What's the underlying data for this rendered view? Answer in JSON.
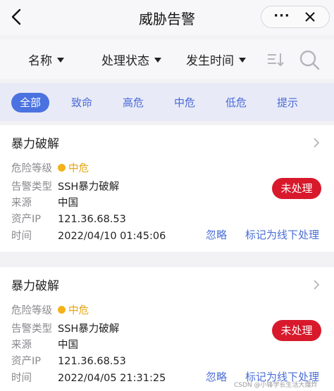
{
  "header": {
    "title": "威胁告警",
    "more_label": "···"
  },
  "filters": [
    {
      "label": "名称"
    },
    {
      "label": "处理状态"
    },
    {
      "label": "发生时间"
    }
  ],
  "tabs": [
    "全部",
    "致命",
    "高危",
    "中危",
    "低危",
    "提示"
  ],
  "active_tab": "全部",
  "fields": {
    "level": "危险等级",
    "type": "告警类型",
    "source": "来源",
    "ip": "资产IP",
    "time": "时间"
  },
  "alerts": [
    {
      "title": "暴力破解",
      "level": "中危",
      "type": "SSH暴力破解",
      "source": "中国",
      "ip": "121.36.68.53",
      "time": "2022/04/10 01:45:06",
      "status": "未处理",
      "ignore": "忽略",
      "mark_offline": "标记为线下处理"
    },
    {
      "title": "暴力破解",
      "level": "中危",
      "type": "SSH暴力破解",
      "source": "中国",
      "ip": "121.36.68.53",
      "time": "2022/04/05 21:31:25",
      "status": "未处理",
      "ignore": "忽略",
      "mark_offline": "标记为线下处理"
    }
  ],
  "watermark": "CSDN @小锋学长生活大爆炸",
  "colors": {
    "accent": "#4a72e0",
    "danger": "#d8192c",
    "warning": "#f3b21a"
  }
}
